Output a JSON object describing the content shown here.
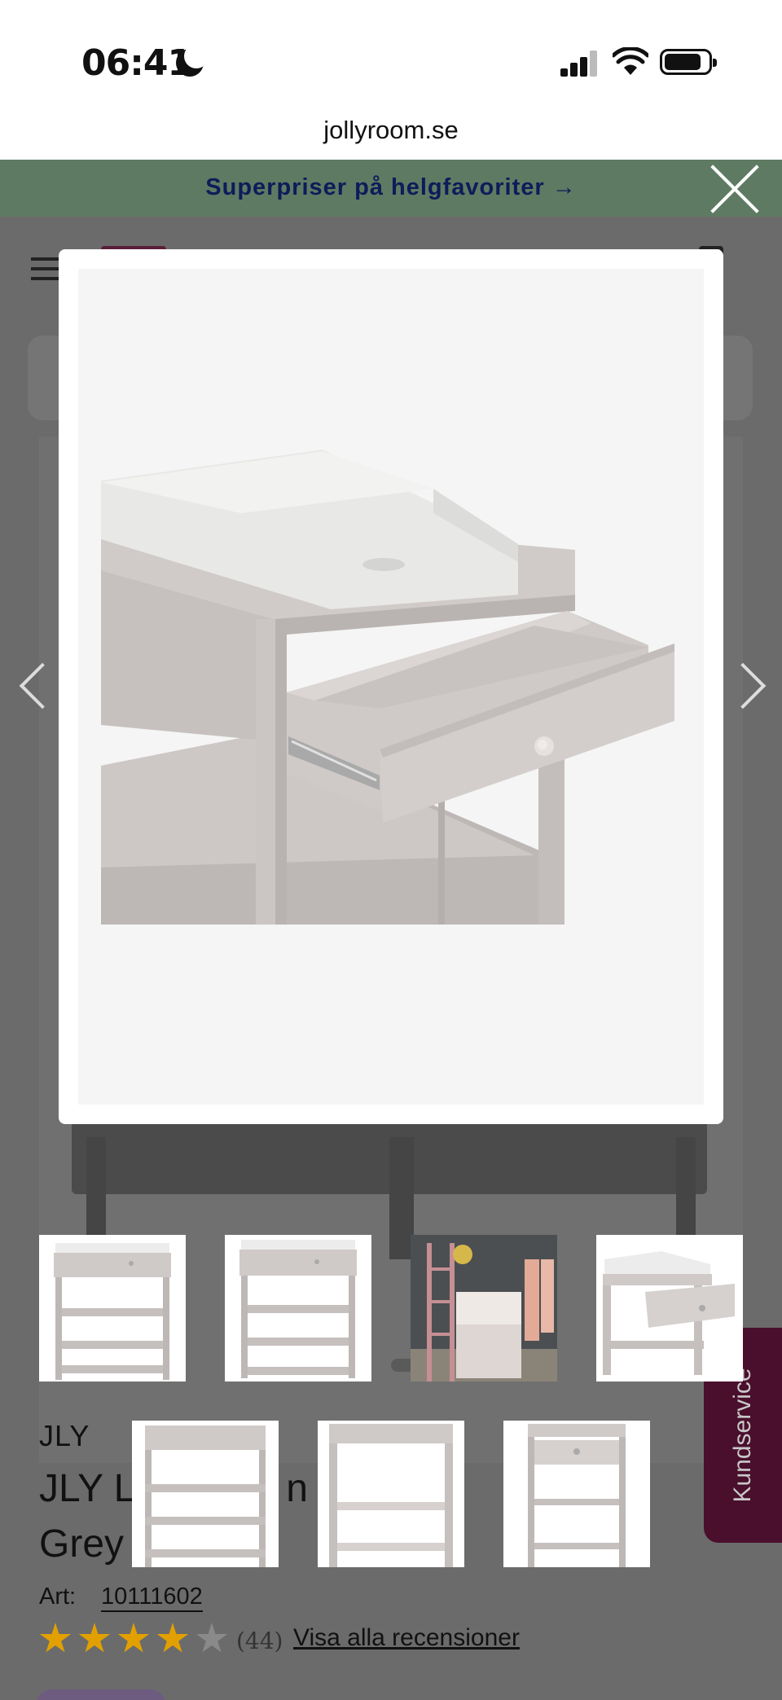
{
  "status_bar": {
    "time": "06:41",
    "icons": [
      "moon-icon",
      "signal-icon",
      "wifi-icon",
      "battery-icon"
    ]
  },
  "browser": {
    "url": "jollyroom.se"
  },
  "promo": {
    "text": "Superpriser på helgfavoriter →"
  },
  "product": {
    "brand": "JLY",
    "title_line1": "JLY L        Lux    ore        n",
    "title_line2": "Grey",
    "art_label": "Art:",
    "art_number": "10111602",
    "rating": 4,
    "rating_max": 5,
    "review_count": "(44)",
    "reviews_link": "Visa alla recensioner"
  },
  "kundservice": {
    "label": "Kundservice"
  },
  "lightbox": {
    "image_alt": "changing-table-with-open-drawer",
    "thumbnails": [
      "changing-table-front",
      "changing-table-front-alt",
      "changing-table-room-scene",
      "changing-table-open-drawer",
      "changing-table-angle",
      "changing-table-side",
      "changing-table-drawer-front"
    ],
    "active_thumbnail": 3
  },
  "colors": {
    "promo_bg": "#5f7a62",
    "promo_text": "#0d1c5a",
    "star_filled": "#e2a000",
    "star_empty": "#8a8a8a",
    "kundservice_bg": "#4a0f2c",
    "furniture_grey": "#c9c4c2"
  }
}
